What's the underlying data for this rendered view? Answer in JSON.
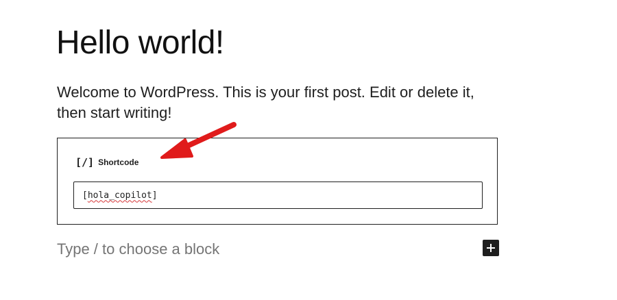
{
  "post": {
    "title": "Hello world!",
    "paragraph": "Welcome to WordPress. This is your first post. Edit or delete it, then start writing!"
  },
  "shortcode_block": {
    "icon": "[/]",
    "label": "Shortcode",
    "value_open": "[",
    "value_word": "hola_copilot",
    "value_close": "]"
  },
  "appender": {
    "placeholder": "Type / to choose a block",
    "add_icon": "plus-icon"
  },
  "annotation": {
    "icon": "red-arrow",
    "color": "#e01b1b"
  }
}
